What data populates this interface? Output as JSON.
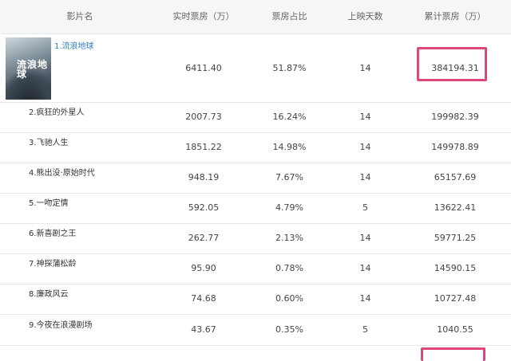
{
  "columns": [
    "影片名",
    "实时票房（万）",
    "票房占比",
    "上映天数",
    "累计票房（万）"
  ],
  "rows": [
    {
      "name": "1.流浪地球",
      "realtime": "6411.40",
      "share": "51.87%",
      "days": "14",
      "total": "384194.31"
    },
    {
      "name": "2.疯狂的外星人",
      "realtime": "2007.73",
      "share": "16.24%",
      "days": "14",
      "total": "199982.39"
    },
    {
      "name": "3.飞驰人生",
      "realtime": "1851.22",
      "share": "14.98%",
      "days": "14",
      "total": "149978.89"
    },
    {
      "name": "4.熊出没·原始时代",
      "realtime": "948.19",
      "share": "7.67%",
      "days": "14",
      "total": "65157.69"
    },
    {
      "name": "5.一吻定情",
      "realtime": "592.05",
      "share": "4.79%",
      "days": "5",
      "total": "13622.41"
    },
    {
      "name": "6.新喜剧之王",
      "realtime": "262.77",
      "share": "2.13%",
      "days": "14",
      "total": "59771.25"
    },
    {
      "name": "7.神探蒲松龄",
      "realtime": "95.90",
      "share": "0.78%",
      "days": "14",
      "total": "14590.15"
    },
    {
      "name": "8.廉政风云",
      "realtime": "74.68",
      "share": "0.60%",
      "days": "14",
      "total": "10727.48"
    },
    {
      "name": "9.今夜在浪漫剧场",
      "realtime": "43.67",
      "share": "0.35%",
      "days": "5",
      "total": "1040.55"
    }
  ],
  "poster": {
    "title_text": "流浪地球"
  },
  "highlight_color": "#e0457b"
}
